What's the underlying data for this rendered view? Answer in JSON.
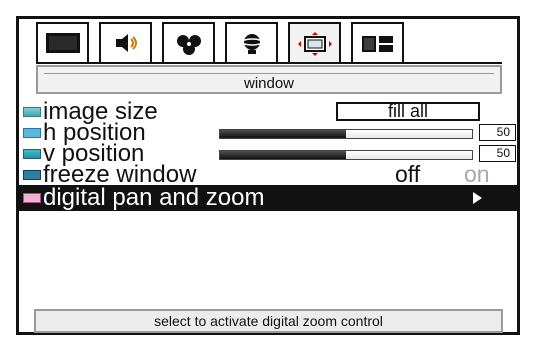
{
  "tabs": [
    {
      "icon": "display-icon",
      "active": false
    },
    {
      "icon": "speaker-icon",
      "active": false
    },
    {
      "icon": "color-dots-icon",
      "active": false
    },
    {
      "icon": "satellite-icon",
      "active": false
    },
    {
      "icon": "window-settings-icon",
      "active": true
    },
    {
      "icon": "layout-panels-icon",
      "active": false
    }
  ],
  "section_title": "window",
  "menu": {
    "image_size": {
      "label": "image size",
      "value": "fill all"
    },
    "h_position": {
      "label": "h position",
      "value": "50",
      "level_percent": 50
    },
    "v_position": {
      "label": "v position",
      "value": "50",
      "level_percent": 50
    },
    "freeze_window": {
      "label": "freeze window",
      "off": "off",
      "on": "on"
    },
    "digital_pan_zoom": {
      "label": "digital pan and zoom"
    }
  },
  "footer_hint": "select to activate digital zoom control",
  "colors": {
    "frame": "#111111",
    "header_bg": "#f1f1f1",
    "highlight_bg": "#111111",
    "inactive_text": "#a8a8a8"
  }
}
